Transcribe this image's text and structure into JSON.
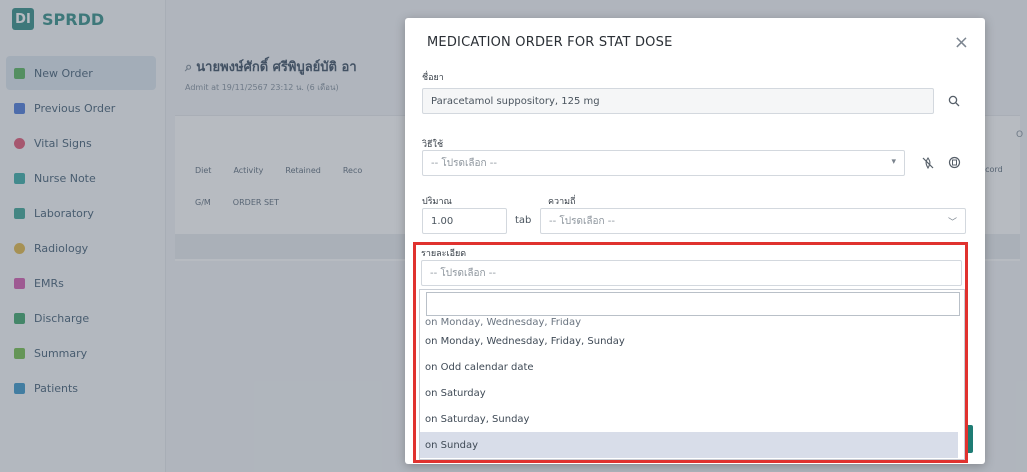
{
  "app": {
    "brand_logo": "DI",
    "brand_name": "SPRDD"
  },
  "sidebar": {
    "items": [
      {
        "label": "New Order",
        "icon": "order-icon",
        "color": "#4caf50"
      },
      {
        "label": "Previous Order",
        "icon": "previous-order-icon",
        "color": "#3f6fd8"
      },
      {
        "label": "Vital Signs",
        "icon": "heart-icon",
        "color": "#e14a6b"
      },
      {
        "label": "Nurse Note",
        "icon": "nurse-icon",
        "color": "#2aa7a1"
      },
      {
        "label": "Laboratory",
        "icon": "lab-icon",
        "color": "#2f9e8f"
      },
      {
        "label": "Radiology",
        "icon": "radiology-icon",
        "color": "#e1b23a"
      },
      {
        "label": "EMRs",
        "icon": "emr-icon",
        "color": "#d24fa9"
      },
      {
        "label": "Discharge",
        "icon": "discharge-icon",
        "color": "#2f9e5f"
      },
      {
        "label": "Summary",
        "icon": "summary-icon",
        "color": "#6abb3e"
      },
      {
        "label": "Patients",
        "icon": "patients-icon",
        "color": "#2a8ec5"
      }
    ]
  },
  "main": {
    "patient_name": "นายพงษ์ศักดิ์ ศรีพิบูลย์บัติ อา",
    "admit_text": "Admit at 19/11/2567 23:12 น. (6 เดือน)",
    "tabs": [
      "Diet",
      "Activity",
      "Retained",
      "Reco"
    ],
    "subtabs": [
      "G/M",
      "ORDER SET"
    ],
    "record_label": "Record",
    "right_edge": "O"
  },
  "modal": {
    "title": "MEDICATION ORDER FOR STAT DOSE",
    "drug_label": "ชื่อยา",
    "drug_value": "Paracetamol suppository, 125 mg",
    "route_label": "วิธีใช้",
    "route_placeholder": "-- โปรดเลือก --",
    "amount_label": "ปริมาณ",
    "amount_value": "1.00",
    "amount_unit": "tab",
    "frequency_label": "ความถี่",
    "frequency_placeholder": "-- โปรดเลือก --",
    "detail_label": "รายละเอียด",
    "detail_placeholder": "-- โปรดเลือก --"
  },
  "dropdown": {
    "search_value": "",
    "partial_option": "on Monday, Wednesday, Friday",
    "options": [
      "on Monday, Wednesday, Friday, Sunday",
      "on Odd calendar date",
      "on Saturday",
      "on Saturday, Sunday",
      "on Sunday"
    ],
    "selected_index": 4
  },
  "colors": {
    "accent": "#23867f",
    "highlight_border": "#e0322f",
    "selected_option": "#d8dde9"
  }
}
